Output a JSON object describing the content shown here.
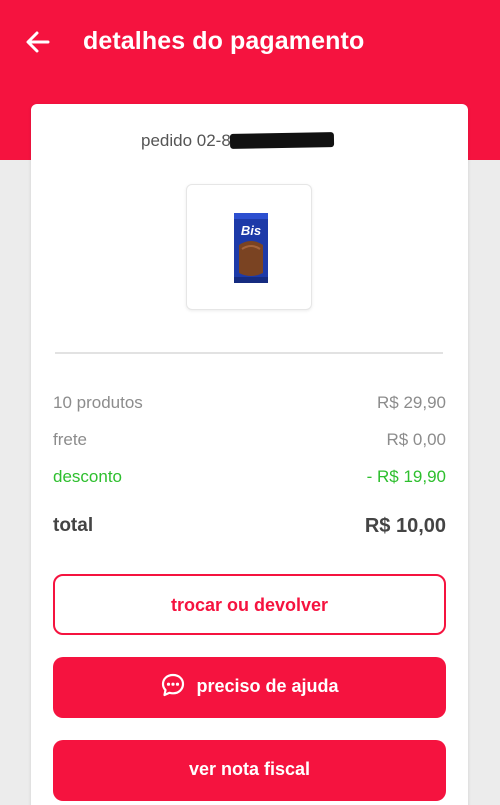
{
  "header": {
    "title": "detalhes do pagamento",
    "back_icon": "arrow-left-icon"
  },
  "order": {
    "label": "pedido 02-89"
  },
  "product": {
    "name": "Bis",
    "image_icon": "chocolate-bar-image"
  },
  "summary": {
    "products_label": "10 produtos",
    "products_value": "R$ 29,90",
    "shipping_label": "frete",
    "shipping_value": "R$ 0,00",
    "discount_label": "desconto",
    "discount_value": "- R$ 19,90",
    "total_label": "total",
    "total_value": "R$ 10,00"
  },
  "actions": {
    "exchange_label": "trocar ou devolver",
    "help_label": "preciso de ajuda",
    "invoice_label": "ver nota fiscal"
  },
  "colors": {
    "brand": "#f5133f",
    "discount": "#2ebf2e",
    "background": "#ececec"
  }
}
